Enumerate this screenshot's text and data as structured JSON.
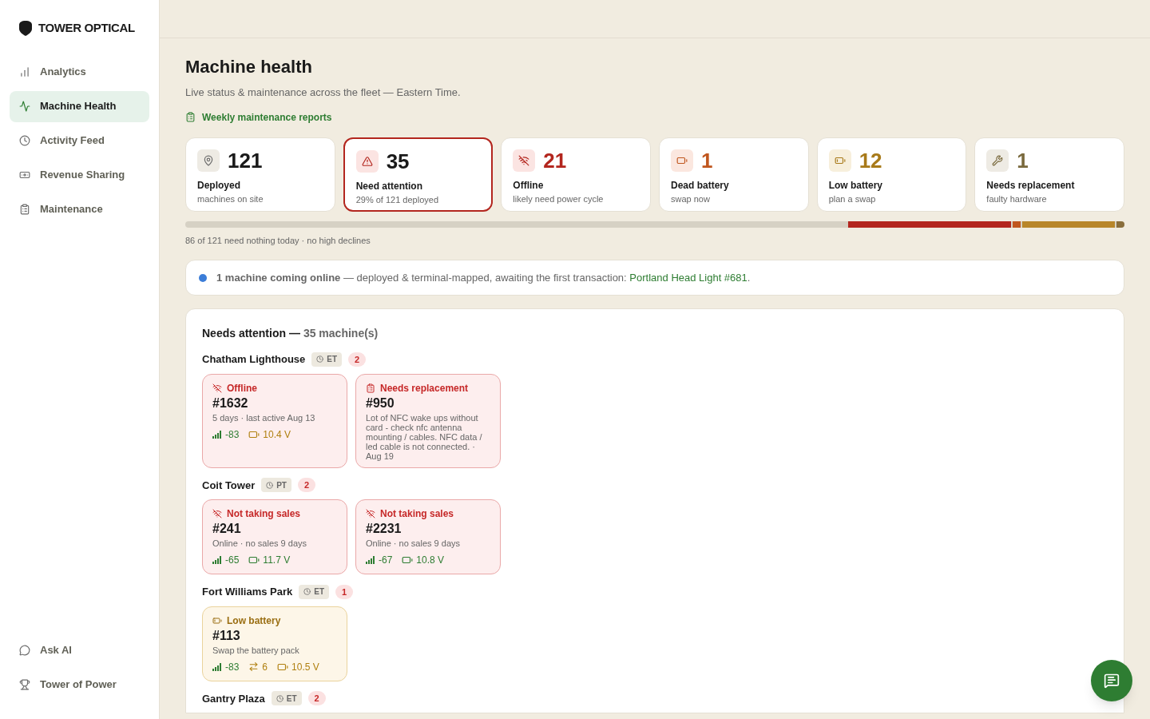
{
  "brand": "TOWER OPTICAL",
  "nav": [
    {
      "label": "Analytics",
      "selected": false
    },
    {
      "label": "Machine Health",
      "selected": true
    },
    {
      "label": "Activity Feed",
      "selected": false
    },
    {
      "label": "Revenue Sharing",
      "selected": false
    },
    {
      "label": "Maintenance",
      "selected": false
    }
  ],
  "nav_bottom": [
    {
      "label": "Ask AI"
    },
    {
      "label": "Tower of Power"
    }
  ],
  "title": "Machine health",
  "subtitle": "Live status & maintenance across the fleet — Eastern Time.",
  "reports_link": "Weekly maintenance reports",
  "stats": [
    {
      "value": "121",
      "label": "Deployed",
      "sub": "machines on site",
      "color": "#1a1a1a",
      "selected": false
    },
    {
      "value": "35",
      "label": "Need attention",
      "sub": "29% of 121 deployed",
      "color": "#1a1a1a",
      "selected": true
    },
    {
      "value": "21",
      "label": "Offline",
      "sub": "likely need power cycle",
      "color": "#b3261e",
      "selected": false
    },
    {
      "value": "1",
      "label": "Dead battery",
      "sub": "swap now",
      "color": "#c0561e",
      "selected": false
    },
    {
      "value": "12",
      "label": "Low battery",
      "sub": "plan a swap",
      "color": "#a87a1a",
      "selected": false
    },
    {
      "value": "1",
      "label": "Needs replacement",
      "sub": "faulty hardware",
      "color": "#7a6a3e",
      "selected": false
    }
  ],
  "fleet_bar": [
    {
      "color": "#b3261e"
    },
    {
      "color": "#c0561e"
    },
    {
      "color": "#b8862a"
    },
    {
      "color": "#8a6e3c"
    }
  ],
  "fleet_note": "86 of 121 need nothing today · no high declines",
  "notice": {
    "text": "**1 machine coming online** — deployed & terminal-mapped, awaiting the first transaction:",
    "link": "Portland Head Light #681",
    "end": "."
  },
  "attention": {
    "title": "Needs attention —",
    "count": "35 machine(s)",
    "sites": [
      {
        "name": "Chatham Lighthouse",
        "zone": "ET",
        "count": "2",
        "machines": [
          {
            "kind": "offline",
            "status": "Offline",
            "id": "#1632",
            "detail": "5 days · last active Aug 13",
            "signal": "-83",
            "battery": "10.4 V",
            "battery_ok": false
          },
          {
            "kind": "replacement",
            "status": "Needs replacement",
            "id": "#950",
            "detail": "Lot of NFC wake ups without card - check nfc antenna mounting / cables. NFC data / led cable is not connected. · Aug 19"
          }
        ]
      },
      {
        "name": "Coit Tower",
        "zone": "PT",
        "count": "2",
        "machines": [
          {
            "kind": "no_sales",
            "status": "Not taking sales",
            "id": "#241",
            "detail": "Online · no sales 9 days",
            "signal": "-65",
            "battery": "11.7 V",
            "battery_ok": true
          },
          {
            "kind": "no_sales",
            "status": "Not taking sales",
            "id": "#2231",
            "detail": "Online · no sales 9 days",
            "signal": "-67",
            "battery": "10.8 V",
            "battery_ok": true
          }
        ]
      },
      {
        "name": "Fort Williams Park",
        "zone": "ET",
        "count": "1",
        "machines": [
          {
            "kind": "low_battery",
            "status": "Low battery",
            "id": "#113",
            "detail": "Swap the battery pack",
            "signal": "-83",
            "swaps": "6",
            "battery": "10.5 V",
            "battery_ok": false
          }
        ]
      },
      {
        "name": "Gantry Plaza",
        "zone": "ET",
        "count": "2"
      }
    ]
  }
}
